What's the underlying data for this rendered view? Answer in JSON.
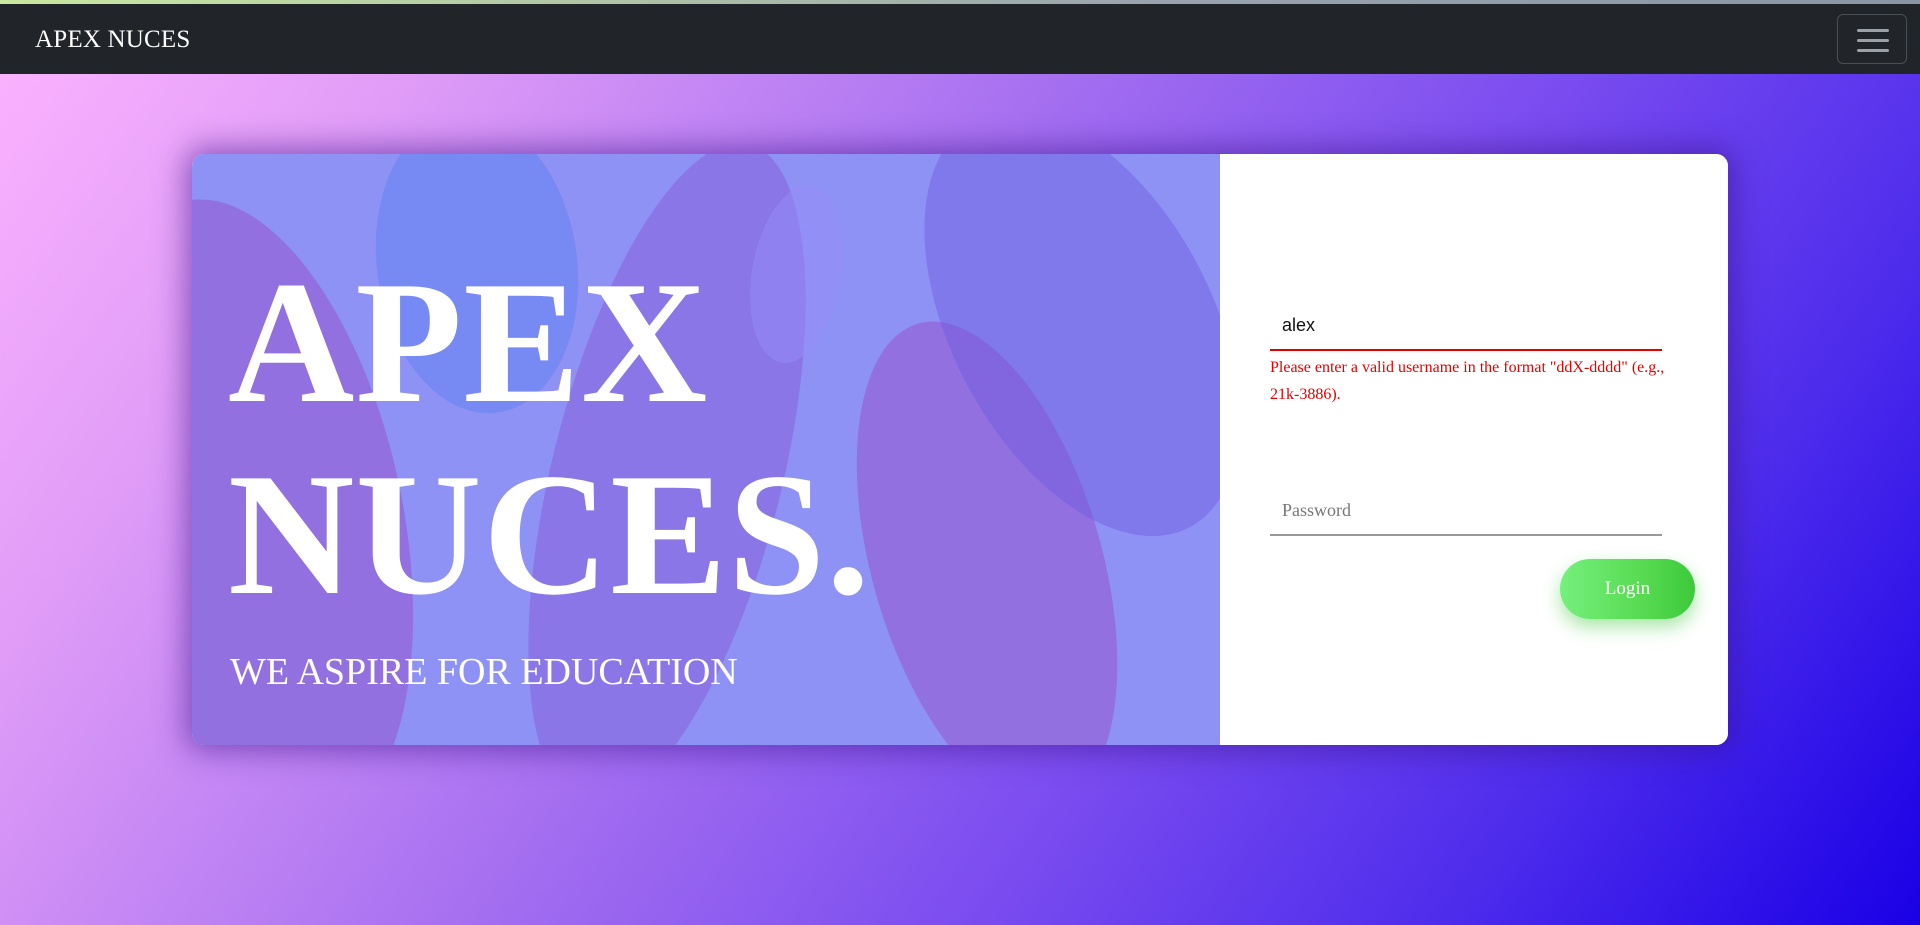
{
  "navbar": {
    "brand": "APEX NUCES",
    "toggler_icon": "hamburger-menu-icon"
  },
  "hero": {
    "title_line1": "APEX",
    "title_line2": "NUCES.",
    "subtitle": "WE ASPIRE FOR EDUCATION"
  },
  "login_form": {
    "username_value": "alex",
    "username_error": "Please enter a valid username in the format \"ddX-dddd\" (e.g., 21k-3886).",
    "password_placeholder": "Password",
    "login_label": "Login"
  },
  "colors": {
    "navbar_bg": "#212529",
    "error": "#e60000",
    "login_button": "#58db52",
    "hero_overlay": "#8f92f5"
  }
}
